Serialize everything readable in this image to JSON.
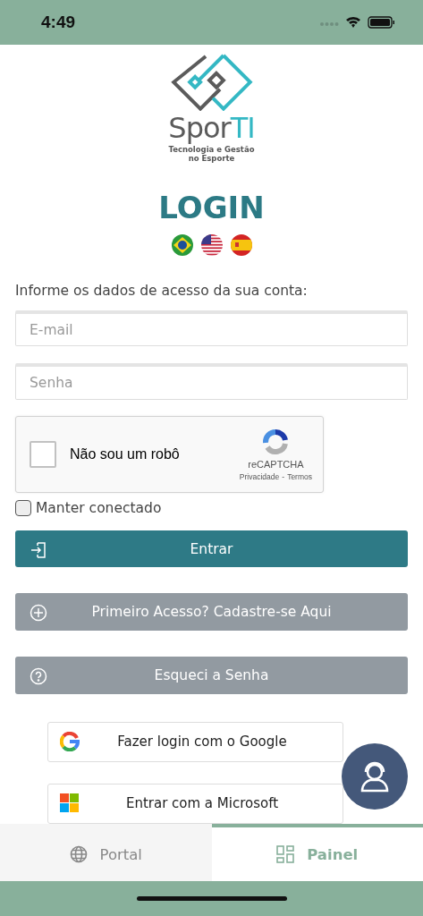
{
  "status_bar": {
    "time": "4:49"
  },
  "logo": {
    "wordmark_parts": [
      "Spor",
      "TI"
    ],
    "tagline": "Tecnologia e Gestão no Esporte"
  },
  "title": "LOGIN",
  "languages": [
    {
      "kind": "br"
    },
    {
      "kind": "us"
    },
    {
      "kind": "es"
    }
  ],
  "instructions": "Informe os dados de acesso da sua conta:",
  "fields": [
    {
      "placeholder": "E-mail"
    },
    {
      "placeholder": "Senha"
    }
  ],
  "captcha": {
    "checked": false,
    "label": "Não sou um robô",
    "brand": "reCAPTCHA",
    "links": [
      "Privacidade",
      "Termos"
    ],
    "separator": "-"
  },
  "keep_connected": {
    "label": "Manter conectado",
    "checked": false
  },
  "buttons": [
    {
      "kind": "login",
      "label": "Entrar"
    },
    {
      "kind": "register",
      "label": "Primeiro Acesso? Cadastre-se Aqui"
    },
    {
      "kind": "forgot",
      "label": "Esqueci a Senha"
    }
  ],
  "social": [
    {
      "kind": "google",
      "label": "Fazer login com o Google"
    },
    {
      "kind": "microsoft",
      "label": "Entrar com a Microsoft"
    }
  ],
  "tabs": [
    {
      "kind": "portal",
      "label": "Portal",
      "selected": false
    },
    {
      "kind": "panel",
      "label": "Painel",
      "selected": true
    }
  ]
}
